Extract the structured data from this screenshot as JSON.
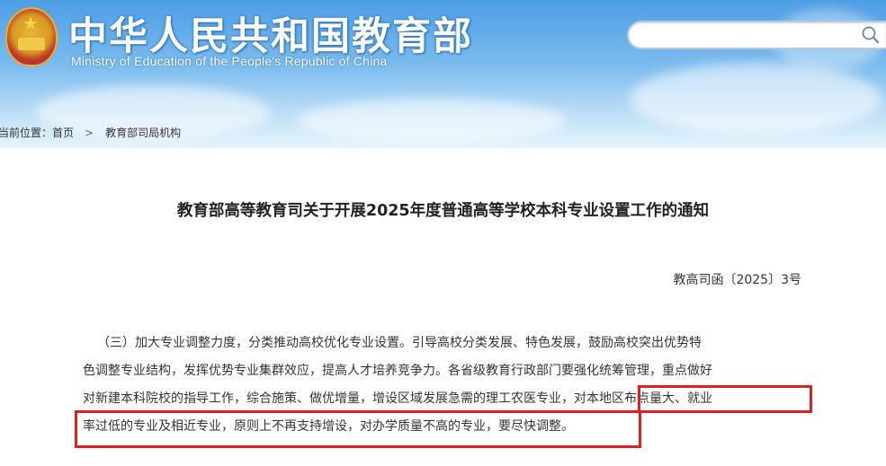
{
  "header": {
    "title_cn": "中华人民共和国教育部",
    "title_en": "Ministry of Education of the People's Republic of China",
    "search_placeholder": "",
    "search_icon": "search-icon"
  },
  "breadcrumb": {
    "label": "当前位置：",
    "items": [
      "首页",
      "教育部司局机构"
    ],
    "separator": ">"
  },
  "article": {
    "title": "教育部高等教育司关于开展2025年度普通高等学校本科专业设置工作的通知",
    "doc_number": "教高司函〔2025〕3号",
    "lines": [
      "（三）加大专业调整力度，分类推动高校优化专业设置。引导高校分类发展、特色发展，鼓励高校突出优势特",
      "色调整专业结构，发挥优势专业集群效应，提高人才培养竞争力。各省级教育行政部门要强化统筹管理，重点做好",
      "对新建本科院校的指导工作，综合施策、做优增量，增设区域发展急需的理工农医专业，对本地区布点量大、就业",
      "率过低的专业及相近专业，原则上不再支持增设，对办学质量不高的专业，要尽快调整。"
    ]
  },
  "colors": {
    "header_blue": "#4d9ee4",
    "highlight_red": "#e02020"
  }
}
